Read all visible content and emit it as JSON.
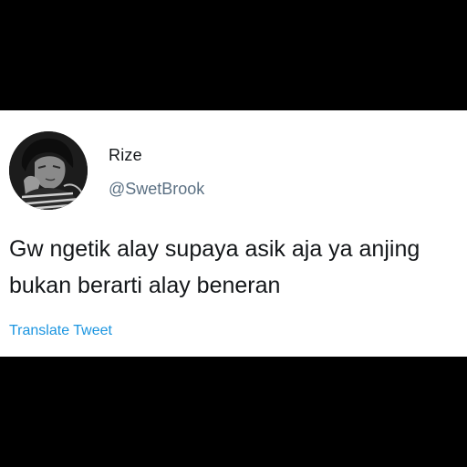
{
  "tweet": {
    "author": {
      "display_name": "Rize",
      "handle": "@SwetBrook",
      "avatar_icon": "profile-photo"
    },
    "text_lines": [
      "Gw ngetik alay supaya asik aja ya anjing",
      "bukan berarti alay beneran"
    ],
    "translate_label": "Translate Tweet"
  },
  "colors": {
    "background": "#000000",
    "card": "#ffffff",
    "text": "#14171a",
    "secondary_text": "#5b7083",
    "link": "#1b95e0"
  }
}
